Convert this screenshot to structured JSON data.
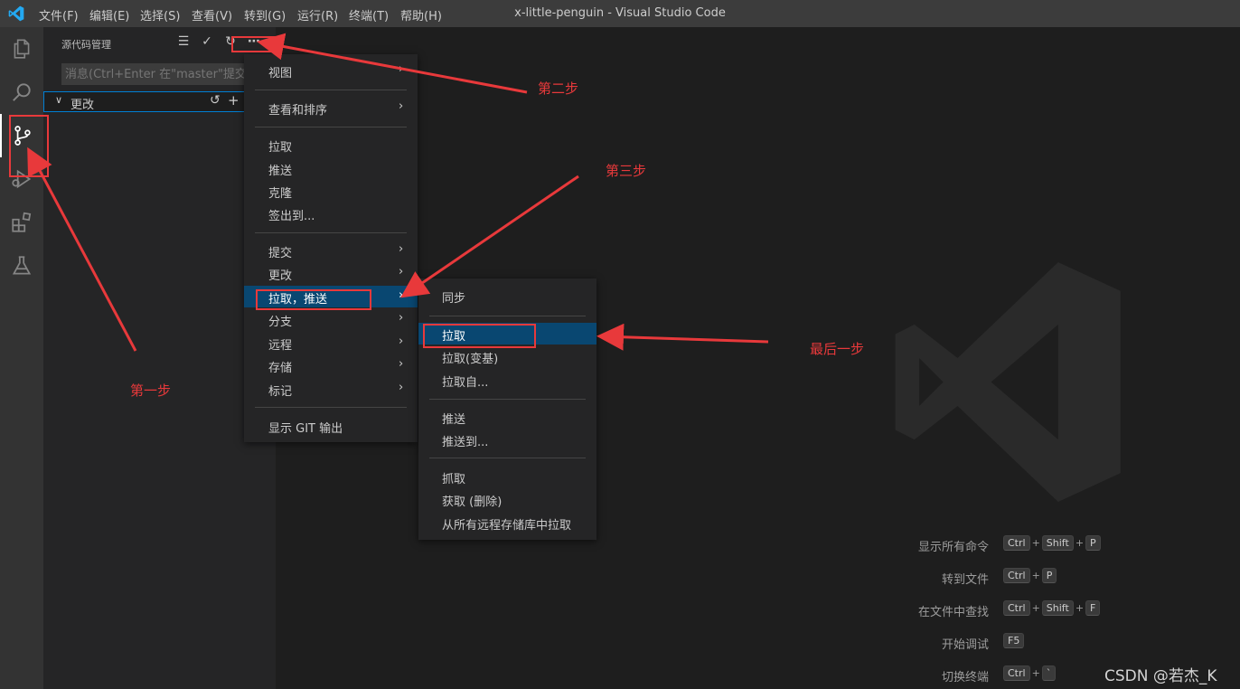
{
  "titlebar": {
    "menus": [
      "文件(F)",
      "编辑(E)",
      "选择(S)",
      "查看(V)",
      "转到(G)",
      "运行(R)",
      "终端(T)",
      "帮助(H)"
    ],
    "window_title": "x-little-penguin - Visual Studio Code"
  },
  "sidebar": {
    "title": "源代码管理",
    "message_placeholder": "消息(Ctrl+Enter 在\"master\"提交)",
    "changes_label": "更改"
  },
  "context_menu": {
    "items": [
      "视图",
      "查看和排序",
      "拉取",
      "推送",
      "克隆",
      "签出到...",
      "提交",
      "更改",
      "拉取，推送",
      "分支",
      "远程",
      "存储",
      "标记",
      "显示 GIT 输出"
    ]
  },
  "submenu": {
    "items": [
      "同步",
      "拉取",
      "拉取(变基)",
      "拉取自...",
      "推送",
      "推送到...",
      "抓取",
      "获取 (删除)",
      "从所有远程存储库中拉取"
    ]
  },
  "shortcuts": [
    {
      "label": "显示所有命令",
      "keys": [
        "Ctrl",
        "Shift",
        "P"
      ]
    },
    {
      "label": "转到文件",
      "keys": [
        "Ctrl",
        "P"
      ]
    },
    {
      "label": "在文件中查找",
      "keys": [
        "Ctrl",
        "Shift",
        "F"
      ]
    },
    {
      "label": "开始调试",
      "keys": [
        "F5"
      ]
    },
    {
      "label": "切换终端",
      "keys": [
        "Ctrl",
        "`"
      ]
    }
  ],
  "annotations": {
    "step1": "第一步",
    "step2": "第二步",
    "step3": "第三步",
    "final": "最后一步"
  },
  "watermark": "CSDN @若杰_K",
  "colors": {
    "accent": "#007acc",
    "highlight": "#094771",
    "annotation_red": "#e8393b"
  }
}
